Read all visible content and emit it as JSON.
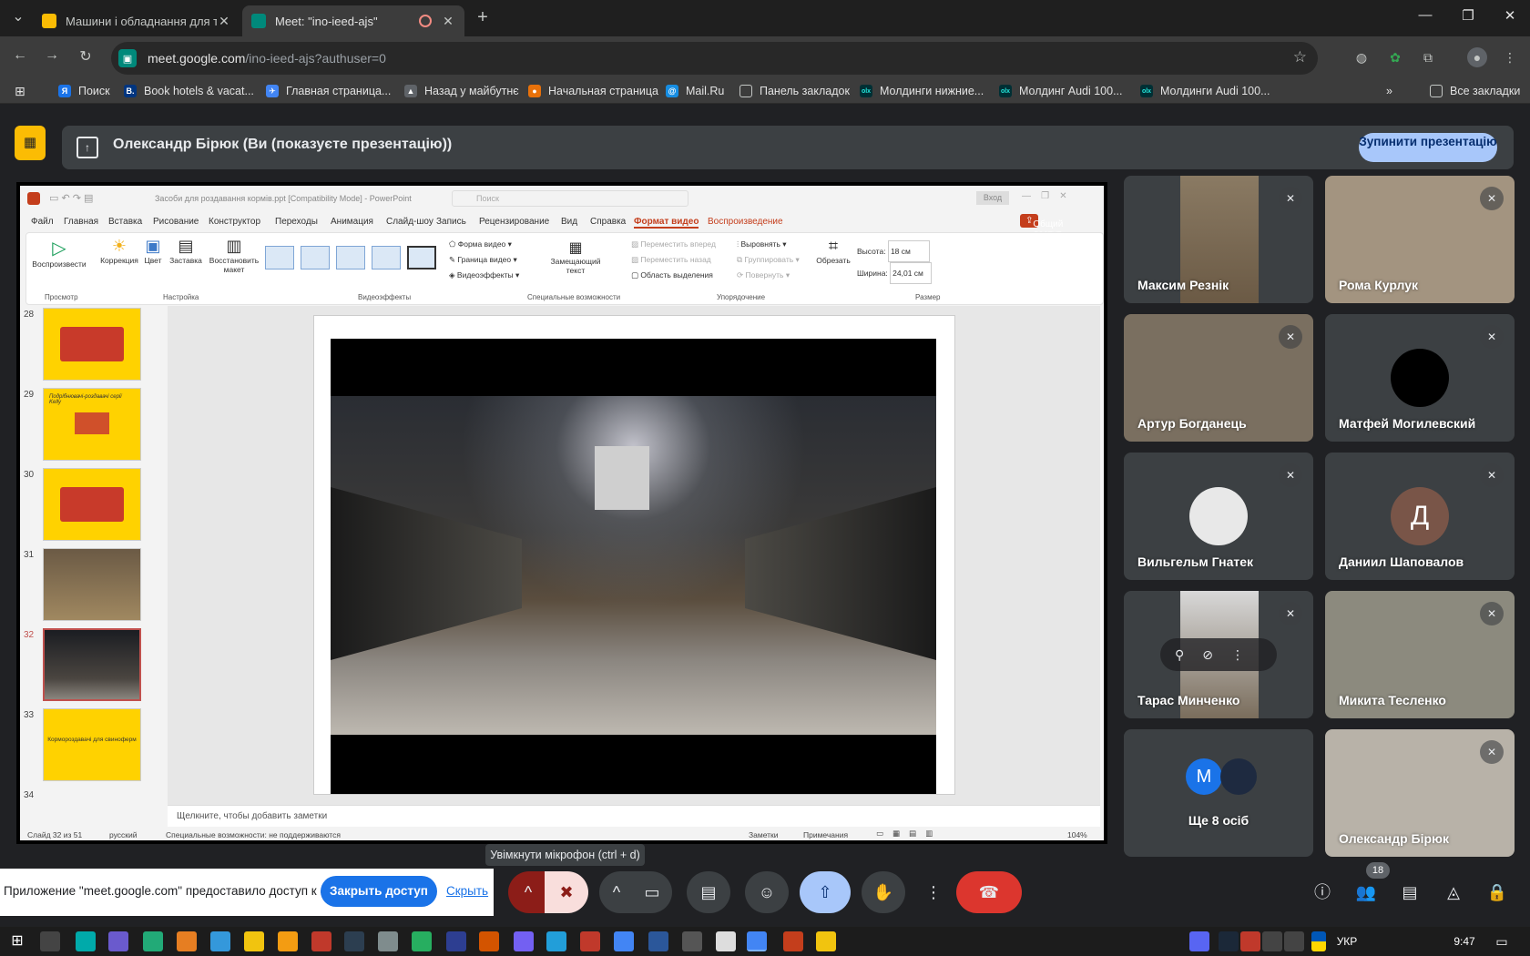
{
  "browser": {
    "tabs": [
      {
        "title": "Машини і обладнання для тв",
        "favicon_color": "#fbbc04",
        "active": false
      },
      {
        "title": "Meet: \"ino-ieed-ajs\"",
        "favicon_color": "#00897b",
        "active": true
      }
    ],
    "url_host": "meet.google.com",
    "url_path": "/ino-ieed-ajs?authuser=0",
    "bookmarks": [
      {
        "label": "Поиск",
        "color": "#1a73e8",
        "glyph": "Я"
      },
      {
        "label": "Book hotels & vacat...",
        "color": "#003580",
        "glyph": "B."
      },
      {
        "label": "Главная страница...",
        "color": "#4285f4",
        "glyph": "✈"
      },
      {
        "label": "Назад у майбутнє",
        "color": "#5f6368",
        "glyph": "▲"
      },
      {
        "label": "Начальная страница",
        "color": "#e8710a",
        "glyph": "●"
      },
      {
        "label": "Mail.Ru",
        "color": "#168de2",
        "glyph": "@"
      },
      {
        "label": "Панель закладок",
        "color": "#5f6368",
        "glyph": "▭"
      },
      {
        "label": "Молдинги нижние...",
        "color": "#23e5db",
        "glyph": "olx"
      },
      {
        "label": "Молдинг Audi 100...",
        "color": "#23e5db",
        "glyph": "olx"
      },
      {
        "label": "Молдинги Audi 100...",
        "color": "#23e5db",
        "glyph": "olx"
      }
    ],
    "more_bookmarks": "»",
    "all_bookmarks": "Все закладки"
  },
  "meet": {
    "presenting_text": "Олександр Бірюк (Ви (показуєте презентацію))",
    "stop_button": "Зупинити презентацію",
    "tooltip": "Увімкнути мікрофон (ctrl + d)",
    "share_notice": "Приложение \"meet.google.com\" предоставило доступ к окну.",
    "close_access": "Закрыть доступ",
    "hide": "Скрыть",
    "participants_count": "18",
    "participants": [
      {
        "name": "Максим Резнік",
        "avatar": "",
        "bg": "#6b5a45"
      },
      {
        "name": "Рома Курлук",
        "avatar": "",
        "bg": "#9a8c78"
      },
      {
        "name": "Артур Богданець",
        "avatar": "",
        "bg": "#7a6f60"
      },
      {
        "name": "Матфей Могилевский",
        "avatar": "",
        "bg": "#3c4043"
      },
      {
        "name": "Вильгельм Гнатек",
        "avatar": "",
        "bg": "#3c4043"
      },
      {
        "name": "Даниил Шаповалов",
        "avatar": "Д",
        "bg": "#3c4043"
      },
      {
        "name": "Тарас Минченко",
        "avatar": "",
        "bg": "#3c4043"
      },
      {
        "name": "Микита Тесленко",
        "avatar": "",
        "bg": "#8c8a7e"
      },
      {
        "name": "Ще 8 осіб",
        "avatar": "M",
        "bg": "#3c4043"
      },
      {
        "name": "Олександр Бірюк",
        "avatar": "",
        "bg": "#b8b2a8"
      }
    ]
  },
  "powerpoint": {
    "title": "Засоби для роздавання кормів.ppt [Compatibility Mode] - PowerPoint",
    "search": "Поиск",
    "signin": "Вход",
    "share": "Общий доступ",
    "menu": [
      "Файл",
      "Главная",
      "Вставка",
      "Рисование",
      "Конструктор",
      "Переходы",
      "Анимация",
      "Слайд-шоу",
      "Запись",
      "Рецензирование",
      "Вид",
      "Справка",
      "Формат видео",
      "Воспроизведение"
    ],
    "ribbon": {
      "play": "Воспроизвести",
      "correction": "Коррекция",
      "color": "Цвет",
      "poster": "Заставка",
      "reset": "Восстановить макет",
      "group_view": "Просмотр",
      "group_setup": "Настройка",
      "group_effects": "Видеоэффекты",
      "shape": "Форма видео",
      "border": "Граница видео",
      "effects": "Видеоэффекты",
      "alt_text": "Замещающий текст",
      "group_access": "Специальные возможности",
      "bring_forward": "Переместить вперед",
      "send_back": "Переместить назад",
      "selection_pane": "Область выделения",
      "align": "Выровнять",
      "group": "Группировать",
      "rotate": "Повернуть",
      "group_arrange": "Упорядочение",
      "crop": "Обрезать",
      "height_label": "Высота:",
      "height_value": "18 см",
      "width_label": "Ширина:",
      "width_value": "24,01 см",
      "group_size": "Размер"
    },
    "thumbs": [
      {
        "num": "28",
        "text": ""
      },
      {
        "num": "29",
        "text": "Подрібнювачі-роздавачі серії Kelly"
      },
      {
        "num": "30",
        "text": ""
      },
      {
        "num": "31",
        "text": ""
      },
      {
        "num": "32",
        "text": ""
      },
      {
        "num": "33",
        "text": "Кормороздавачі для свиноферм"
      },
      {
        "num": "34",
        "text": ""
      }
    ],
    "notes_placeholder": "Щелкните, чтобы добавить заметки",
    "status_slide": "Слайд 32 из 51",
    "status_lang": "русский",
    "status_access": "Специальные возможности: не поддерживаются",
    "status_notes": "Заметки",
    "status_comments": "Примечания",
    "zoom": "104%"
  },
  "taskbar": {
    "lang": "УКР",
    "time": "9:47"
  }
}
